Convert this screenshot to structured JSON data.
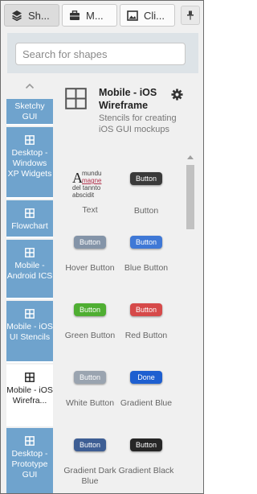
{
  "tabs": [
    {
      "label": "Sh...",
      "icon": "layers-icon",
      "active": true
    },
    {
      "label": "M...",
      "icon": "briefcase-icon",
      "active": false
    },
    {
      "label": "Cli...",
      "icon": "image-icon",
      "active": false
    }
  ],
  "pin_icon": "pin-icon",
  "search": {
    "placeholder": "Search for shapes"
  },
  "categories": [
    {
      "label": "Sketchy GUI",
      "icon": "grid-icon"
    },
    {
      "label": "Desktop - Windows XP Widgets",
      "icon": "grid-icon"
    },
    {
      "label": "Flowchart",
      "icon": "grid-icon"
    },
    {
      "label": "Mobile - Android ICS",
      "icon": "grid-icon"
    },
    {
      "label": "Mobile - iOS UI Stencils",
      "icon": "grid-icon"
    },
    {
      "label": "Mobile - iOS Wirefra...",
      "icon": "grid-icon",
      "selected": true
    },
    {
      "label": "Desktop - Prototype GUI",
      "icon": "grid-icon"
    }
  ],
  "collection": {
    "title": "Mobile - iOS Wireframe",
    "description": "Stencils for creating iOS GUI mockups"
  },
  "shapes": [
    {
      "label": "Text",
      "preview_words": [
        "mundu",
        "magne",
        "del tannto",
        "abscidit"
      ],
      "preview_letter": "A"
    },
    {
      "label": "Button",
      "button_text": "Button",
      "color": "#3a3a3a"
    },
    {
      "label": "Hover Button",
      "button_text": "Button",
      "color": "#8494a8"
    },
    {
      "label": "Blue Button",
      "button_text": "Button",
      "color": "#3f78d6"
    },
    {
      "label": "Green Button",
      "button_text": "Button",
      "color": "#4fae32"
    },
    {
      "label": "Red Button",
      "button_text": "Button",
      "color": "#d64a4a"
    },
    {
      "label": "White Button",
      "button_text": "Button",
      "color": "#9aa4b0"
    },
    {
      "label": "Gradient Blue",
      "button_text": "Done",
      "color": "#1e5fd0"
    },
    {
      "label": "Gradient Dark Blue",
      "button_text": "Button",
      "color": "#3e5e94"
    },
    {
      "label": "Gradient Black",
      "button_text": "Button",
      "color": "#262626"
    }
  ]
}
